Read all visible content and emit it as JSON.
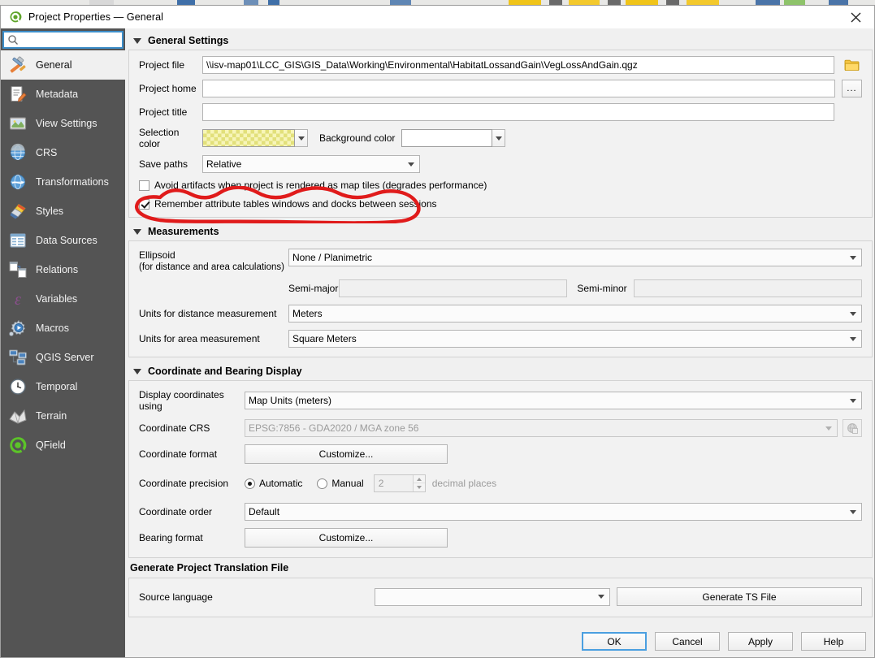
{
  "window": {
    "title": "Project Properties — General",
    "app_icon": "qgis-logo-icon",
    "close_icon": "close-icon"
  },
  "sidebar": {
    "search": {
      "value": "",
      "placeholder": "",
      "icon": "search-icon"
    },
    "items": [
      {
        "label": "General",
        "icon": "hammer-wrench-icon",
        "selected": true
      },
      {
        "label": "Metadata",
        "icon": "document-pencil-icon",
        "selected": false
      },
      {
        "label": "View Settings",
        "icon": "map-frame-icon",
        "selected": false
      },
      {
        "label": "CRS",
        "icon": "globe-grid-icon",
        "selected": false
      },
      {
        "label": "Transformations",
        "icon": "globe-arrows-icon",
        "selected": false
      },
      {
        "label": "Styles",
        "icon": "paintbrush-icon",
        "selected": false
      },
      {
        "label": "Data Sources",
        "icon": "table-grid-icon",
        "selected": false
      },
      {
        "label": "Relations",
        "icon": "linked-tables-icon",
        "selected": false
      },
      {
        "label": "Variables",
        "icon": "epsilon-icon",
        "selected": false
      },
      {
        "label": "Macros",
        "icon": "gear-play-icon",
        "selected": false
      },
      {
        "label": "QGIS Server",
        "icon": "servers-icon",
        "selected": false
      },
      {
        "label": "Temporal",
        "icon": "clock-icon",
        "selected": false
      },
      {
        "label": "Terrain",
        "icon": "terrain-mesh-icon",
        "selected": false
      },
      {
        "label": "QField",
        "icon": "qfield-logo-icon",
        "selected": false
      }
    ]
  },
  "general_settings": {
    "title": "General Settings",
    "project_file": {
      "label": "Project file",
      "value": "\\\\isv-map01\\LCC_GIS\\GIS_Data\\Working\\Environmental\\HabitatLossandGain\\VegLossAndGain.qgz",
      "browse_icon": "folder-icon"
    },
    "project_home": {
      "label": "Project home",
      "value": "",
      "browse_label": "..."
    },
    "project_title": {
      "label": "Project title",
      "value": ""
    },
    "selection_color": {
      "label": "Selection color",
      "value": "#f7f5b8",
      "swatch": "yellow-checkered"
    },
    "background_color": {
      "label": "Background color",
      "value": "#ffffff"
    },
    "save_paths": {
      "label": "Save paths",
      "value": "Relative"
    },
    "avoid_artifacts": {
      "label": "Avoid artifacts when project is rendered as map tiles (degrades performance)",
      "checked": false
    },
    "remember_tables": {
      "label": "Remember attribute tables windows and docks between sessions",
      "checked": true,
      "annotated": true
    }
  },
  "measurements": {
    "title": "Measurements",
    "ellipsoid": {
      "label_line1": "Ellipsoid",
      "label_line2": "(for distance and area calculations)",
      "value": "None / Planimetric"
    },
    "semi_major": {
      "label": "Semi-major",
      "value": ""
    },
    "semi_minor": {
      "label": "Semi-minor",
      "value": ""
    },
    "distance_units": {
      "label": "Units for distance measurement",
      "value": "Meters"
    },
    "area_units": {
      "label": "Units for area measurement",
      "value": "Square Meters"
    }
  },
  "coordinate_display": {
    "title": "Coordinate and Bearing Display",
    "display_using": {
      "label": "Display coordinates using",
      "value": "Map Units (meters)"
    },
    "coordinate_crs": {
      "label": "Coordinate CRS",
      "value": "EPSG:7856 - GDA2020 / MGA zone 56",
      "disabled": true,
      "select_icon": "crs-globe-icon"
    },
    "coordinate_format": {
      "label": "Coordinate format",
      "button": "Customize..."
    },
    "coordinate_precision": {
      "label": "Coordinate precision",
      "automatic_label": "Automatic",
      "manual_label": "Manual",
      "mode": "Automatic",
      "decimals_value": "2",
      "decimals_suffix": "decimal places"
    },
    "coordinate_order": {
      "label": "Coordinate order",
      "value": "Default"
    },
    "bearing_format": {
      "label": "Bearing format",
      "button": "Customize..."
    }
  },
  "translation": {
    "title": "Generate Project Translation File",
    "source_language": {
      "label": "Source language",
      "value": ""
    },
    "generate_button": "Generate TS File"
  },
  "footer": {
    "ok": "OK",
    "cancel": "Cancel",
    "apply": "Apply",
    "help": "Help"
  },
  "annotation": {
    "color": "#e01b1b",
    "shape": "hand-drawn-ellipse-highlight"
  }
}
